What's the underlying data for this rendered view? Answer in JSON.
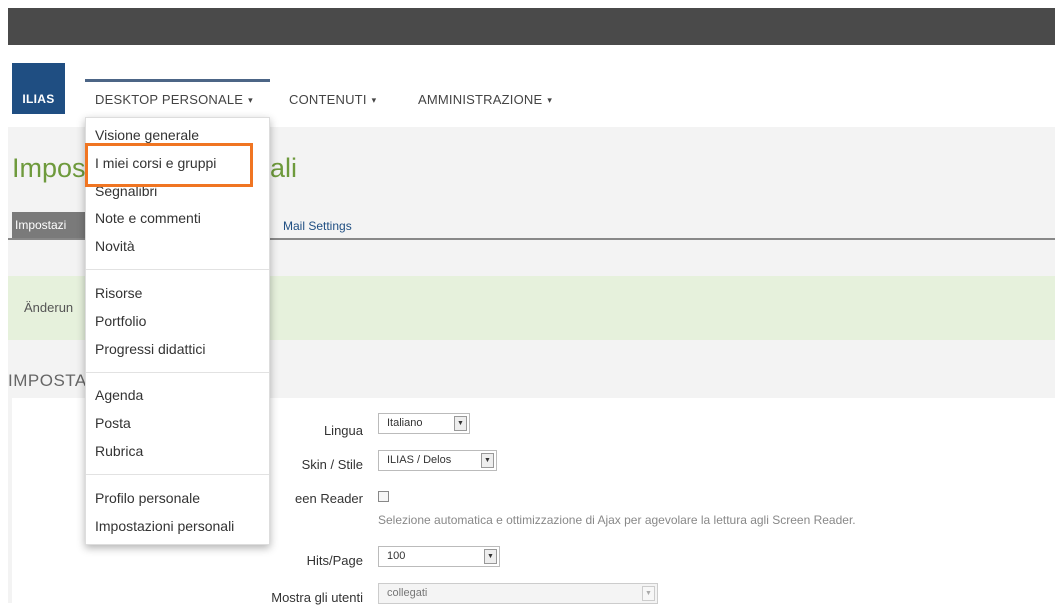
{
  "header": {
    "logo_text": "ILIAS",
    "nav": [
      {
        "label": "DESKTOP PERSONALE"
      },
      {
        "label": "CONTENUTI"
      },
      {
        "label": "AMMINISTRAZIONE"
      }
    ],
    "caret": "▾"
  },
  "page": {
    "title_start": "Impos",
    "title_end": "ali",
    "tab_active_label": "Impostazi",
    "tab_mail_label": "Mail Settings",
    "message_text": "Änderun",
    "section_title": "IMPOSTA"
  },
  "dropdown": {
    "groups": [
      [
        "Visione generale",
        "I miei corsi e gruppi",
        "Segnalibri",
        "Note e commenti",
        "Novità"
      ],
      [
        "Risorse",
        "Portfolio",
        "Progressi didattici"
      ],
      [
        "Agenda",
        "Posta",
        "Rubrica"
      ],
      [
        "Profilo personale",
        "Impostazioni personali"
      ]
    ],
    "highlighted_item": "I miei corsi e gruppi",
    "highlight_color": "#f07522"
  },
  "form": {
    "lingua_label": "Lingua",
    "lingua_value": "Italiano",
    "skin_label": "Skin / Stile",
    "skin_value": "ILIAS / Delos",
    "screen_reader_label": "een Reader",
    "screen_reader_help": "Selezione automatica e ottimizzazione di Ajax per agevolare la lettura agli Screen Reader.",
    "hits_label": "Hits/Page",
    "hits_value": "100",
    "mostra_label": "Mostra gli utenti",
    "mostra_value": "collegati"
  },
  "colors": {
    "topbar": "#4a4a4a",
    "logo_bg": "#1f4e82",
    "title_green": "#6e9a3c",
    "message_bg": "#e6f1dc"
  }
}
